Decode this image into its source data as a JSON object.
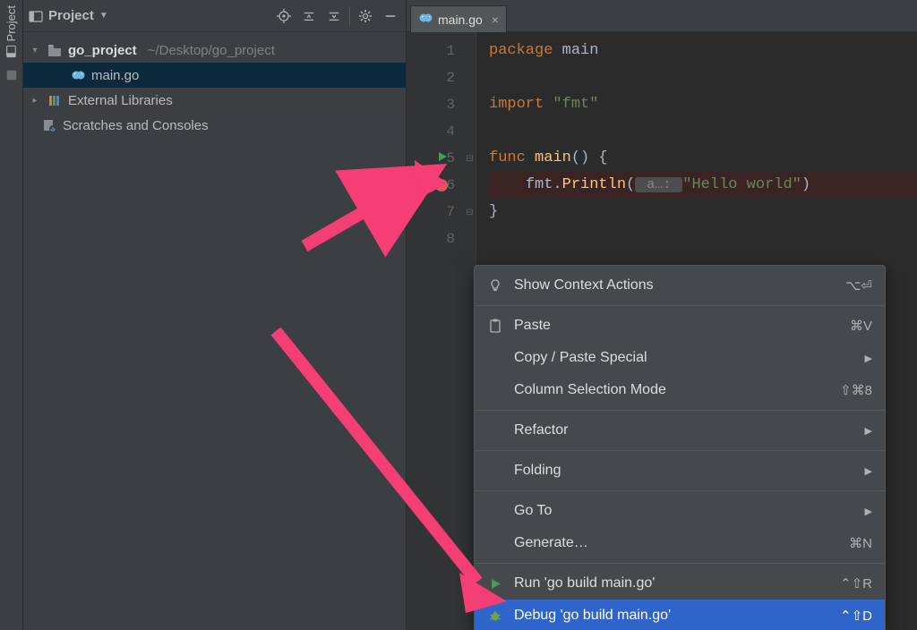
{
  "rail": {
    "project_label": "Project"
  },
  "project_panel": {
    "title": "Project",
    "toolbar_icons": [
      "target-icon",
      "collapse-icon",
      "settings-sliders-icon",
      "gear-icon",
      "minimize-icon"
    ]
  },
  "tree": {
    "root": {
      "name": "go_project",
      "path": "~/Desktop/go_project"
    },
    "file": {
      "name": "main.go"
    },
    "ext": {
      "name": "External Libraries"
    },
    "scratch": {
      "name": "Scratches and Consoles"
    }
  },
  "editor_tab": {
    "name": "main.go"
  },
  "gutter": {
    "lines": [
      "1",
      "2",
      "3",
      "4",
      "5",
      "6",
      "7",
      "8"
    ],
    "run_line": 5,
    "breakpoint_line": 6
  },
  "code": {
    "l1": {
      "kw": "package ",
      "id": "main"
    },
    "l2": "",
    "l3": {
      "kw": "import ",
      "str": "\"fmt\""
    },
    "l4": "",
    "l5": {
      "kw": "func ",
      "id": "main",
      "rest": "() {"
    },
    "l6": {
      "indent": "    ",
      "pkg": "fmt",
      "dot": ".",
      "fn": "Println",
      "open": "(",
      "hint": " a…: ",
      "str": "\"Hello world\"",
      "close": ")"
    },
    "l7": "}",
    "l8": ""
  },
  "menu": {
    "items": [
      {
        "icon": "bulb-icon",
        "label": "Show Context Actions",
        "shortcut": "⌥⏎",
        "submenu": false
      },
      {
        "sep": true
      },
      {
        "icon": "paste-icon",
        "label": "Paste",
        "shortcut": "⌘V",
        "submenu": false
      },
      {
        "icon": "",
        "label": "Copy / Paste Special",
        "shortcut": "",
        "submenu": true
      },
      {
        "icon": "",
        "label": "Column Selection Mode",
        "shortcut": "⇧⌘8",
        "submenu": false
      },
      {
        "sep": true
      },
      {
        "icon": "",
        "label": "Refactor",
        "shortcut": "",
        "submenu": true
      },
      {
        "sep": true
      },
      {
        "icon": "",
        "label": "Folding",
        "shortcut": "",
        "submenu": true
      },
      {
        "sep": true
      },
      {
        "icon": "",
        "label": "Go To",
        "shortcut": "",
        "submenu": true
      },
      {
        "icon": "",
        "label": "Generate…",
        "shortcut": "⌘N",
        "submenu": false
      },
      {
        "sep": true
      },
      {
        "icon": "run-icon",
        "label": "Run 'go build main.go'",
        "shortcut": "⌃⇧R",
        "submenu": false
      },
      {
        "icon": "debug-icon",
        "label": "Debug 'go build main.go'",
        "shortcut": "⌃⇧D",
        "submenu": false,
        "selected": true
      }
    ]
  },
  "icons": {
    "folder": "folder-icon",
    "go_file": "go-file-icon",
    "lib": "library-icon",
    "scratch": "scratch-icon"
  }
}
